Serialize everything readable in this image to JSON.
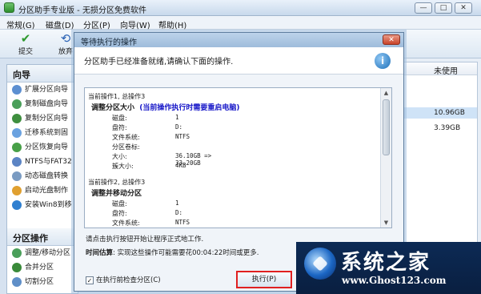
{
  "window": {
    "title": "分区助手专业版 - 无损分区免费软件",
    "min_glyph": "—",
    "max_glyph": "□",
    "close_glyph": "✕"
  },
  "menu": [
    "常规(G)",
    "磁盘(D)",
    "分区(P)",
    "向导(W)",
    "帮助(H)"
  ],
  "toolbar": {
    "commit": "提交",
    "discard": "放弃"
  },
  "sidebar": {
    "wizard_header": "向导",
    "wizard_items": [
      "扩展分区向导",
      "复制磁盘向导",
      "复制分区向导",
      "迁移系统到固",
      "分区恢复向导",
      "NTFS与FAT32",
      "动态磁盘转换",
      "启动光盘制作",
      "安装Win8到移"
    ],
    "ops_header": "分区操作",
    "ops_items": [
      "调整/移动分区",
      "合并分区",
      "切割分区"
    ]
  },
  "disk_table": {
    "column_unused": "未使用",
    "rows": [
      "10.96GB",
      "3.39GB"
    ]
  },
  "dialog": {
    "title": "等待执行的操作",
    "close_glyph": "✕",
    "message": "分区助手已经准备就绪,请确认下面的操作.",
    "info_glyph": "i",
    "operations": [
      {
        "title": "当前操作1, 总操作3",
        "name": "调整分区大小",
        "warning": "(当前操作执行时需要重启电脑)",
        "props": [
          {
            "k": "磁盘:",
            "v": "1"
          },
          {
            "k": "盘符:",
            "v": "D:"
          },
          {
            "k": "文件系统:",
            "v": "NTFS"
          },
          {
            "k": "分区卷标:",
            "v": ""
          },
          {
            "k": "大小:",
            "v": "36.10GB => 33.20GB"
          },
          {
            "k": "簇大小:",
            "v": "4KB"
          }
        ]
      },
      {
        "title": "当前操作2, 总操作3",
        "name": "调整并移动分区",
        "warning": "",
        "props": [
          {
            "k": "磁盘:",
            "v": "1"
          },
          {
            "k": "盘符:",
            "v": "D:"
          },
          {
            "k": "文件系统:",
            "v": "NTFS"
          }
        ]
      }
    ],
    "footnote1": "请点击执行按钮开始让程序正式地工作.",
    "estimate_label": "时间估算",
    "estimate_text": ": 实现这些操作可能需要花00:04:22时间或更多.",
    "checkbox_mark": "✓",
    "checkbox_label": "在执行前检查分区(C)",
    "execute_button": "执行(P)"
  },
  "watermark": {
    "brand": "系统之家",
    "url": "www.Ghost123.com"
  }
}
